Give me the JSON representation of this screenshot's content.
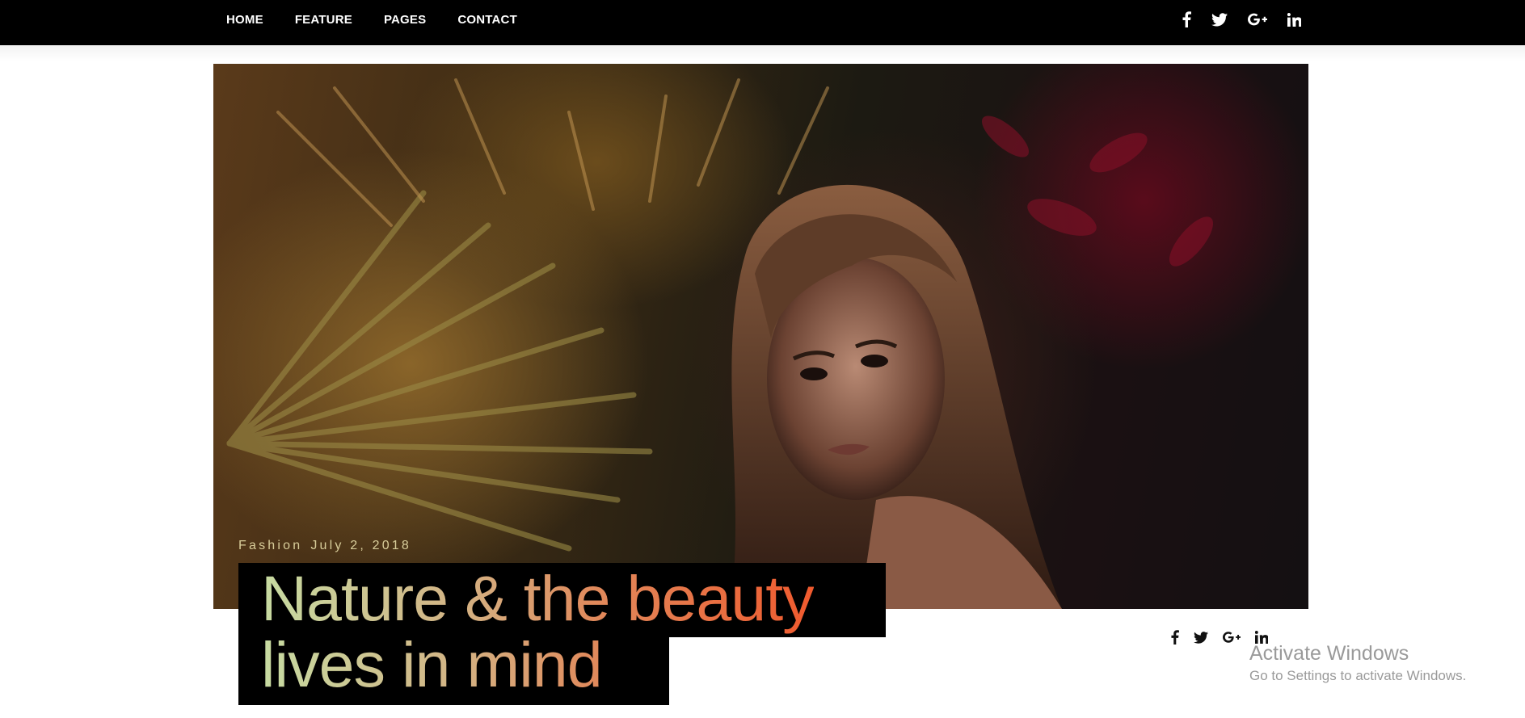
{
  "nav": {
    "links": [
      {
        "label": "HOME"
      },
      {
        "label": "FEATURE"
      },
      {
        "label": "PAGES"
      },
      {
        "label": "CONTACT"
      }
    ],
    "social_icons": [
      "facebook-icon",
      "twitter-icon",
      "google-plus-icon",
      "linkedin-icon"
    ],
    "background_color": "#000000",
    "text_color": "#ffffff"
  },
  "post": {
    "category": "Fashion",
    "date": "July 2, 2018",
    "title_line1_part1": "Nature & the ",
    "title_line1_part2": "beauty",
    "title_line2": "lives in mind",
    "social_icons": [
      "facebook-icon",
      "twitter-icon",
      "google-plus-icon",
      "linkedin-icon"
    ],
    "title_gradient": [
      "#c7dba2",
      "#d3b485",
      "#e08a5c",
      "#f05a2e"
    ],
    "meta_color": "#d8cd9a"
  },
  "watermark": {
    "title": "Activate Windows",
    "subtitle": "Go to Settings to activate Windows."
  }
}
